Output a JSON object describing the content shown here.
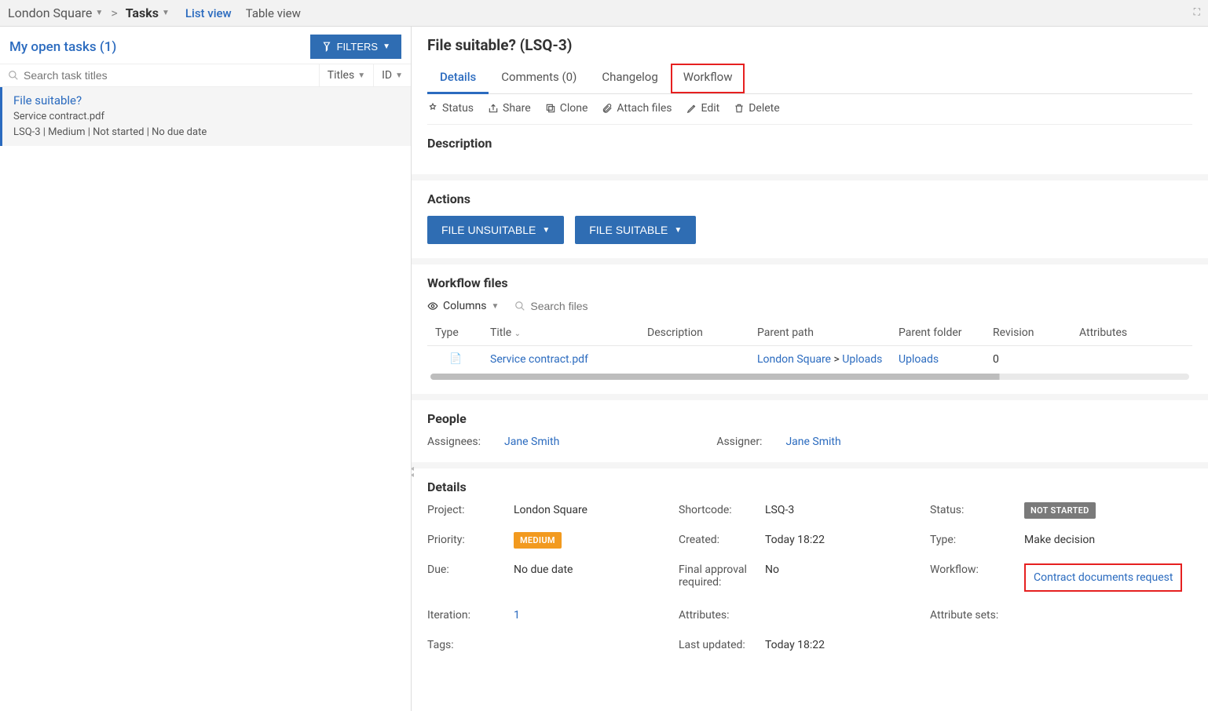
{
  "breadcrumb": {
    "project": "London Square",
    "section": "Tasks"
  },
  "views": {
    "list": "List view",
    "table": "Table view"
  },
  "left": {
    "title": "My open tasks (1)",
    "filters_label": "FILTERS",
    "search_placeholder": "Search task titles",
    "sort_titles": "Titles",
    "sort_id": "ID",
    "task": {
      "title": "File suitable?",
      "file": "Service contract.pdf",
      "meta": "LSQ-3 | Medium | Not started | No due date"
    }
  },
  "right": {
    "heading": "File suitable? (LSQ-3)",
    "tabs": {
      "details": "Details",
      "comments": "Comments (0)",
      "changelog": "Changelog",
      "workflow": "Workflow"
    },
    "toolbar": {
      "status": "Status",
      "share": "Share",
      "clone": "Clone",
      "attach": "Attach files",
      "edit": "Edit",
      "delete": "Delete"
    },
    "description_h": "Description",
    "actions_h": "Actions",
    "actions": {
      "unsuitable": "FILE UNSUITABLE",
      "suitable": "FILE SUITABLE"
    },
    "wf_h": "Workflow files",
    "columns_label": "Columns",
    "files_search_placeholder": "Search files",
    "wf_cols": {
      "type": "Type",
      "title": "Title",
      "description": "Description",
      "parent_path": "Parent path",
      "parent_folder": "Parent folder",
      "revision": "Revision",
      "attributes": "Attributes"
    },
    "wf_row": {
      "title": "Service contract.pdf",
      "parent_path_a": "London Square",
      "parent_path_sep": " > ",
      "parent_path_b": "Uploads",
      "parent_folder": "Uploads",
      "revision": "0"
    },
    "people_h": "People",
    "people": {
      "assignees_l": "Assignees:",
      "assignees_v": "Jane Smith",
      "assigner_l": "Assigner:",
      "assigner_v": "Jane Smith"
    },
    "details_h": "Details",
    "details": {
      "project_l": "Project:",
      "project_v": "London Square",
      "shortcode_l": "Shortcode:",
      "shortcode_v": "LSQ-3",
      "status_l": "Status:",
      "status_v": "NOT STARTED",
      "priority_l": "Priority:",
      "priority_v": "MEDIUM",
      "created_l": "Created:",
      "created_v": "Today 18:22",
      "type_l": "Type:",
      "type_v": "Make decision",
      "due_l": "Due:",
      "due_v": "No due date",
      "final_l": "Final approval required:",
      "final_v": "No",
      "workflow_l": "Workflow:",
      "workflow_v": "Contract documents request",
      "iteration_l": "Iteration:",
      "iteration_v": "1",
      "attributes_l": "Attributes:",
      "attrsets_l": "Attribute sets:",
      "tags_l": "Tags:",
      "updated_l": "Last updated:",
      "updated_v": "Today 18:22"
    }
  }
}
